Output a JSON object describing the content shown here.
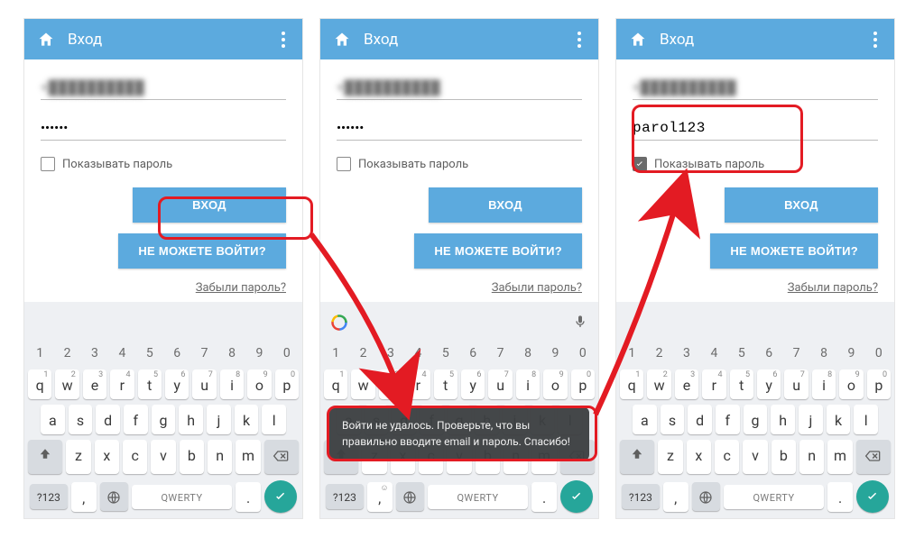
{
  "appbar": {
    "title": "Вход"
  },
  "form": {
    "email_prefix": "+",
    "password_masked": "••••••",
    "password_plain": "parol123",
    "show_password_label": "Показывать пароль",
    "login_button": "ВХОД",
    "cant_login_button": "НЕ МОЖЕТЕ ВОЙТИ?",
    "forgot_link": "Забыли пароль?"
  },
  "toast": {
    "message": "Войти не удалось. Проверьте, что вы правильно вводите email и пароль. Спасибо!"
  },
  "keyboard": {
    "numbers": [
      "1",
      "2",
      "3",
      "4",
      "5",
      "6",
      "7",
      "8",
      "9",
      "0"
    ],
    "row1": [
      "q",
      "w",
      "e",
      "r",
      "t",
      "y",
      "u",
      "i",
      "o",
      "p"
    ],
    "row2": [
      "a",
      "s",
      "d",
      "f",
      "g",
      "h",
      "j",
      "k",
      "l"
    ],
    "row3": [
      "z",
      "x",
      "c",
      "v",
      "b",
      "n",
      "m"
    ],
    "sym_key": "?123",
    "space_label": "QWERTY",
    "comma": ",",
    "period": "."
  }
}
